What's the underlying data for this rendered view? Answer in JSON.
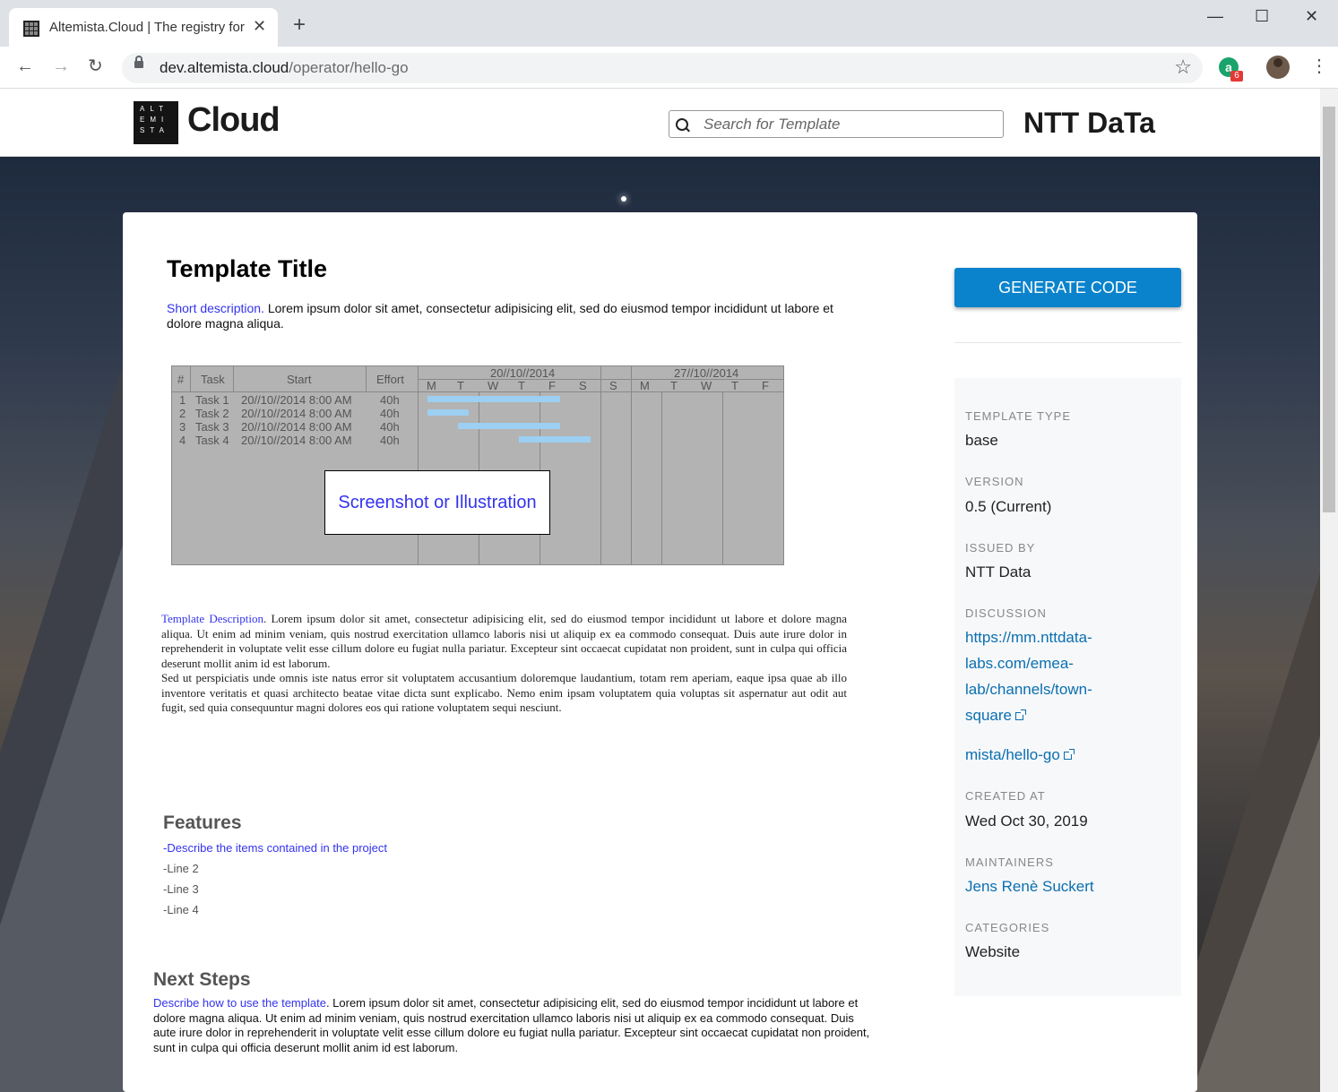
{
  "browser": {
    "tab_title": "Altemista.Cloud | The registry for",
    "url_host": "dev.altemista.cloud",
    "url_path": "/operator/hello-go",
    "extension_badge": "6"
  },
  "header": {
    "logo_letters": "ALT EMI STA",
    "logo_text": "Cloud",
    "search_placeholder": "Search for Template",
    "brand": "NTT DaTa"
  },
  "template": {
    "title": "Template Title",
    "short_desc_label": "Short description.",
    "short_desc_text": " Lorem ipsum dolor sit amet, consectetur adipisicing elit, sed do eiusmod tempor incididunt ut labore et dolore magna aliqua.",
    "screenshot_label": "Screenshot or Illustration",
    "gantt": {
      "col_num": "#",
      "col_task": "Task",
      "col_start": "Start",
      "col_effort": "Effort",
      "week1": "20//10//2014",
      "week2": "27//10//2014",
      "days": [
        "M",
        "T",
        "W",
        "T",
        "F",
        "S",
        "S",
        "M",
        "T",
        "W",
        "T",
        "F"
      ],
      "rows": [
        {
          "n": "1",
          "task": "Task 1",
          "start": "20//10//2014 8:00 AM",
          "effort": "40h"
        },
        {
          "n": "2",
          "task": "Task 2",
          "start": "20//10//2014 8:00 AM",
          "effort": "40h"
        },
        {
          "n": "3",
          "task": "Task 3",
          "start": "20//10//2014 8:00 AM",
          "effort": "40h"
        },
        {
          "n": "4",
          "task": "Task 4",
          "start": "20//10//2014 8:00 AM",
          "effort": "40h"
        }
      ]
    },
    "desc_label": "Template Description",
    "desc_text_1": ". Lorem ipsum dolor sit amet, consectetur adipisicing elit, sed do eiusmod tempor incididunt ut labore et dolore magna aliqua. Ut enim ad minim veniam, quis nostrud exercitation ullamco laboris nisi ut aliquip ex ea commodo consequat. Duis aute irure dolor in reprehenderit in voluptate velit esse cillum dolore eu fugiat nulla pariatur. Excepteur sint occaecat cupidatat non proident, sunt in culpa qui officia deserunt mollit anim id est laborum.",
    "desc_text_2": "Sed ut perspiciatis unde omnis iste natus error sit voluptatem accusantium doloremque laudantium, totam rem aperiam, eaque ipsa quae ab illo inventore veritatis et quasi architecto beatae vitae dicta sunt explicabo. Nemo enim ipsam voluptatem quia voluptas sit aspernatur aut odit aut fugit, sed quia consequuntur magni dolores eos qui ratione voluptatem sequi nesciunt.",
    "features_heading": "Features",
    "features": [
      "-Describe the items contained in the project",
      "-Line 2",
      "-Line 3",
      "-Line 4"
    ],
    "next_heading": "Next Steps",
    "next_label": "Describe how to use the template",
    "next_text": ". Lorem ipsum dolor sit amet, consectetur adipisicing elit, sed do eiusmod tempor incididunt ut labore et dolore magna aliqua. Ut enim ad minim veniam, quis nostrud exercitation ullamco laboris nisi ut aliquip ex ea commodo consequat. Duis aute irure dolor in reprehenderit in voluptate velit esse cillum dolore eu fugiat nulla pariatur. Excepteur sint occaecat cupidatat non proident, sunt in culpa qui officia deserunt mollit anim id est laborum."
  },
  "sidebar": {
    "generate_label": "GENERATE CODE",
    "type_label": "TEMPLATE TYPE",
    "type_value": "base",
    "version_label": "VERSION",
    "version_value": "0.5 (Current)",
    "issued_label": "ISSUED BY",
    "issued_value": "NTT Data",
    "discussion_label": "DISCUSSION",
    "discussion_link_1": "https://mm.nttdata-",
    "discussion_link_2": "labs.com/emea-",
    "discussion_link_3": "lab/channels/town-",
    "discussion_link_4": "square",
    "repo_link": "mista/hello-go",
    "created_label": "CREATED AT",
    "created_value": "Wed Oct 30, 2019",
    "maintainers_label": "MAINTAINERS",
    "maintainers_value": "Jens Renè Suckert",
    "categories_label": "CATEGORIES",
    "categories_value": "Website"
  }
}
